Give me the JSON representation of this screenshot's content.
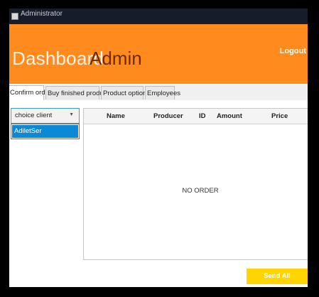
{
  "window": {
    "title": "Administrator"
  },
  "header": {
    "title_part1": "Dashboard",
    "title_part2": "Admin",
    "logout_label": "Logout",
    "colors": {
      "bar": "#ff8a1d",
      "title_light": "#fff2e4",
      "title_dark": "#6e2d00"
    }
  },
  "tabs": [
    {
      "label": "Confirm order",
      "active": true
    },
    {
      "label": "Buy finished product",
      "active": false
    },
    {
      "label": "Product options",
      "active": false
    },
    {
      "label": "Employees",
      "active": false
    }
  ],
  "client_select": {
    "value": "choice client",
    "options": [
      "AdiletSer"
    ]
  },
  "orders_table": {
    "columns": [
      "Name",
      "Producer",
      "ID",
      "Amount",
      "Price"
    ],
    "empty_text": "NO ORDER"
  },
  "actions": {
    "send_all_label": "Send All",
    "send_all_color": "#ffd400"
  },
  "icons": {
    "app": "app-icon",
    "dropdown": "chevron-down-icon"
  }
}
